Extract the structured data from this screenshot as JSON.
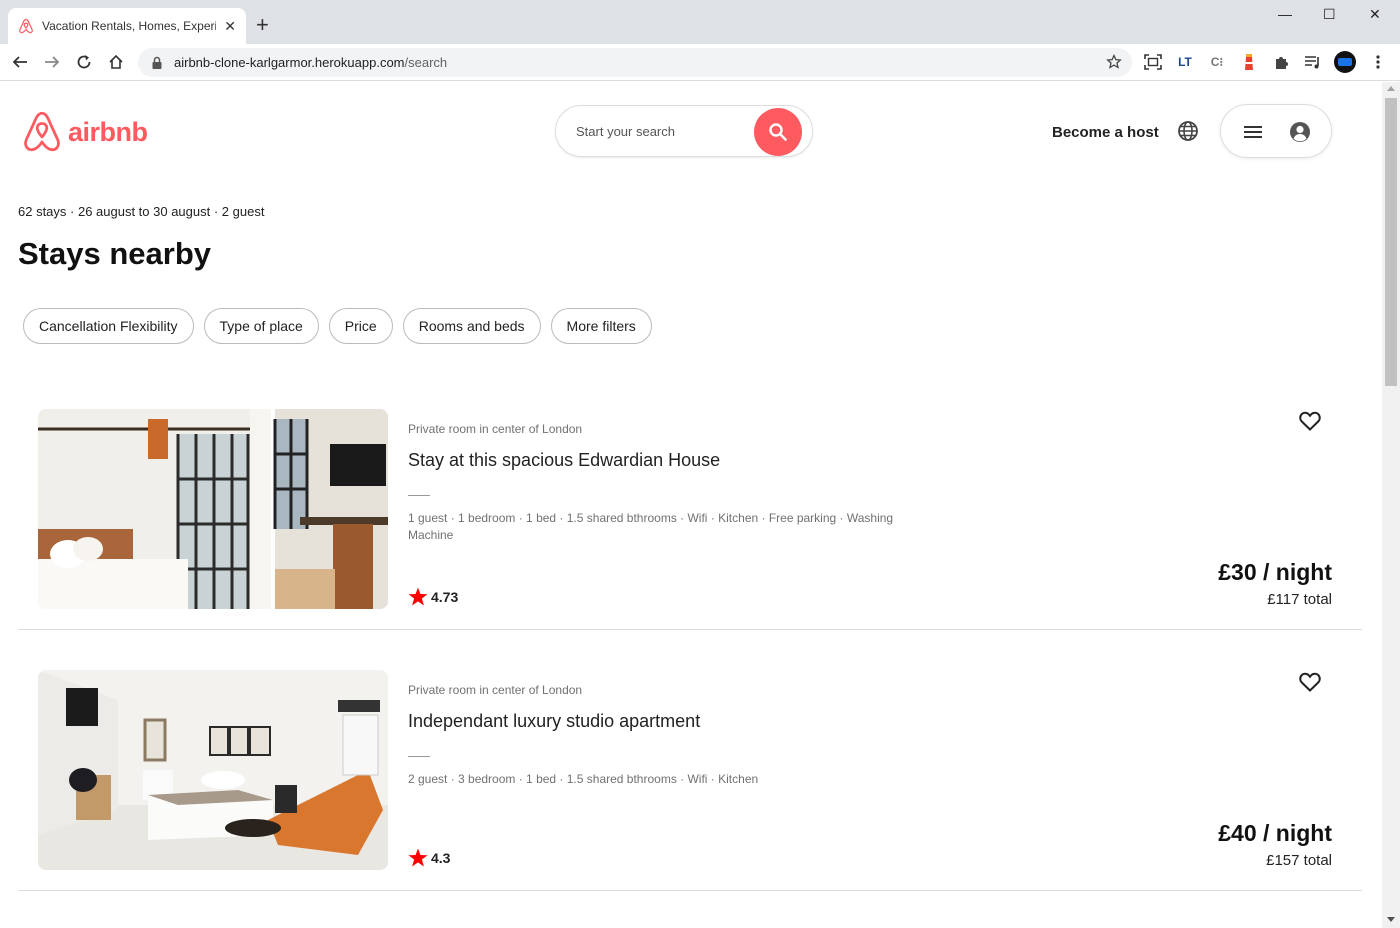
{
  "browser": {
    "tab_title": "Vacation Rentals, Homes, Experie",
    "url_host": "airbnb-clone-karlgarmor.herokuapp.com",
    "url_path": "/search"
  },
  "header": {
    "logo_text": "airbnb",
    "search_placeholder": "Start your search",
    "become_host": "Become a host"
  },
  "results": {
    "meta": "62 stays · 26 august to 30 august · 2 guest",
    "title": "Stays nearby"
  },
  "filters": [
    "Cancellation Flexibility",
    "Type of place",
    "Price",
    "Rooms and beds",
    "More filters"
  ],
  "listings": [
    {
      "type": "Private room in center of London",
      "title": "Stay at this spacious Edwardian House",
      "amenities": "1 guest · 1 bedroom · 1 bed · 1.5 shared bthrooms · Wifi · Kitchen · Free parking · Washing Machine",
      "rating": "4.73",
      "price": "£30 / night",
      "total": "£117 total"
    },
    {
      "type": "Private room in center of London",
      "title": "Independant luxury studio apartment",
      "amenities": "2 guest · 3 bedroom · 1 bed · 1.5 shared bthrooms · Wifi · Kitchen",
      "rating": "4.3",
      "price": "£40 / night",
      "total": "£157 total"
    }
  ],
  "colors": {
    "brand": "#ff5a5f",
    "star": "#ff0000"
  }
}
